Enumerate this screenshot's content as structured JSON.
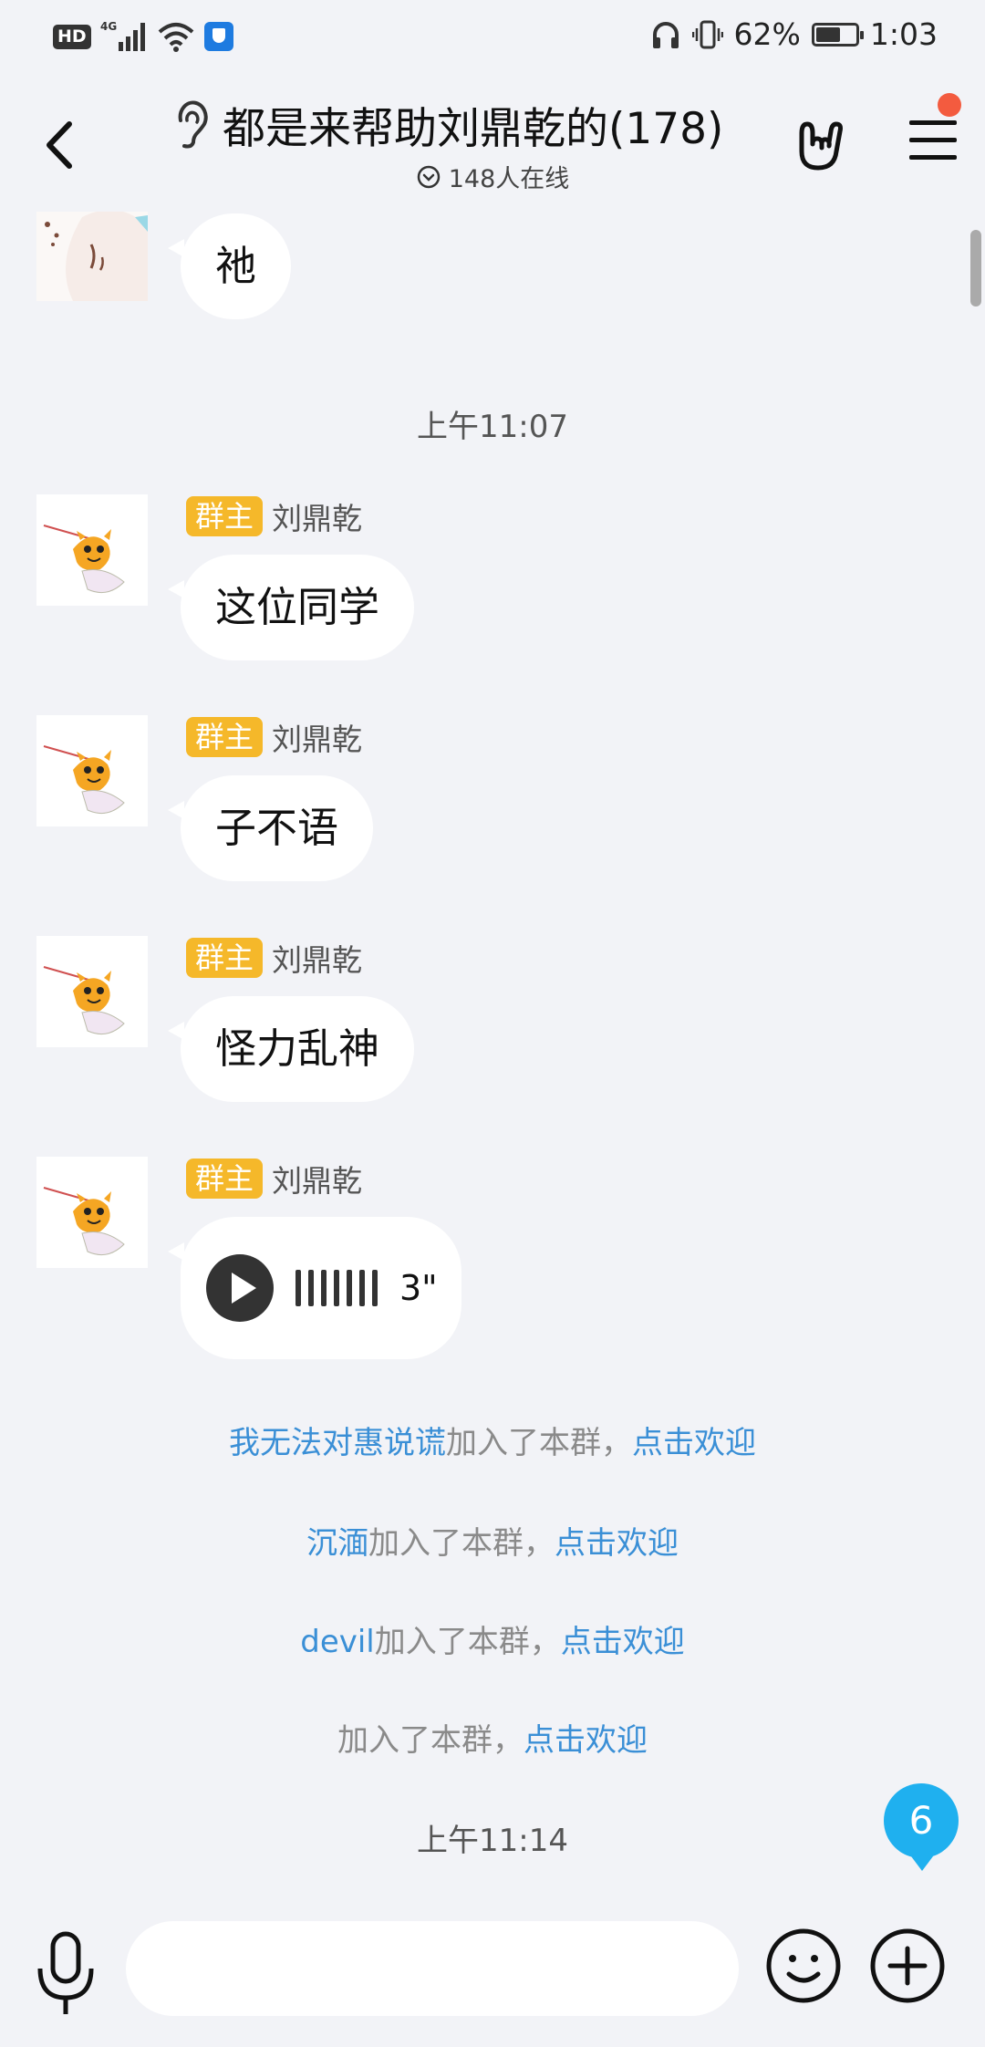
{
  "status_bar": {
    "network_label": "HD",
    "signal_label": "4G",
    "battery_percent": "62%",
    "battery_level": 0.62,
    "time": "1:03"
  },
  "header": {
    "title": "都是来帮助刘鼎乾的(178)",
    "online_count": "148人在线",
    "menu_has_notification": true
  },
  "messages": [
    {
      "type": "text",
      "text": "祂"
    },
    {
      "type": "time",
      "text": "上午11:07"
    },
    {
      "type": "text",
      "badge": "群主",
      "sender": "刘鼎乾",
      "text": "这位同学"
    },
    {
      "type": "text",
      "badge": "群主",
      "sender": "刘鼎乾",
      "text": "子不语"
    },
    {
      "type": "text",
      "badge": "群主",
      "sender": "刘鼎乾",
      "text": "怪力乱神"
    },
    {
      "type": "voice",
      "badge": "群主",
      "sender": "刘鼎乾",
      "duration": "3\""
    }
  ],
  "system_notices": [
    {
      "name": "我无法对惠说谎",
      "join_text": "加入了本群，",
      "action": "点击欢迎"
    },
    {
      "name": "沉湎",
      "join_text": "加入了本群，",
      "action": "点击欢迎"
    },
    {
      "name": "devil",
      "join_text": "加入了本群，",
      "action": "点击欢迎"
    },
    {
      "name": "",
      "join_text": "加入了本群，",
      "action": "点击欢迎"
    }
  ],
  "time_after_notices": "上午11:14",
  "unread_count": "6",
  "input": {
    "value": "",
    "placeholder": ""
  },
  "colors": {
    "owner_badge": "#f5b82a",
    "link": "#3a8fd6",
    "unread_badge": "#1fb0ef",
    "notification_dot": "#f35b3f"
  }
}
